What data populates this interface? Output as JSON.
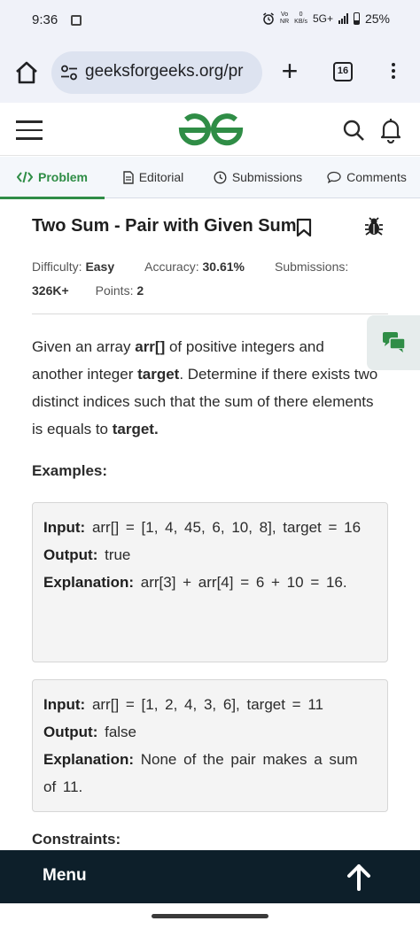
{
  "status_bar": {
    "time": "9:36",
    "network_top": "0",
    "network_bottom": "KB/s",
    "vo_top": "Vo",
    "vo_bottom": "NR",
    "signal": "5G+",
    "battery": "25%"
  },
  "browser": {
    "url": "geeksforgeeks.org/pr",
    "tab_count": "16"
  },
  "tabs": [
    {
      "label": "Problem",
      "icon": "code-icon",
      "active": true
    },
    {
      "label": "Editorial",
      "icon": "document-icon",
      "active": false
    },
    {
      "label": "Submissions",
      "icon": "clock-icon",
      "active": false
    },
    {
      "label": "Comments",
      "icon": "chat-bubble-icon",
      "active": false
    }
  ],
  "problem": {
    "title": "Two Sum - Pair with Given Sum",
    "difficulty_label": "Difficulty:",
    "difficulty_value": "Easy",
    "accuracy_label": "Accuracy:",
    "accuracy_value": "30.61%",
    "submissions_label": "Submissions:",
    "submissions_value": "326K+",
    "points_label": "Points:",
    "points_value": "2",
    "description": {
      "p1": "Given an array ",
      "b1": "arr[]",
      "p2": " of positive integers and another integer ",
      "b2": "target",
      "p3": ". Determine if there exists two distinct indices such that the sum of there elements is equals to ",
      "b3": "target."
    },
    "examples_heading": "Examples:",
    "examples": [
      {
        "input_label": "Input:",
        "input": "arr[] = [1, 4, 45, 6, 10, 8], target = 16",
        "output_label": "Output:",
        "output": "true",
        "explanation_label": "Explanation:",
        "explanation": "arr[3] + arr[4] = 6 + 10 = 16."
      },
      {
        "input_label": "Input:",
        "input": "arr[] = [1, 2, 4, 3, 6], target = 11",
        "output_label": "Output:",
        "output": "false",
        "explanation_label": "Explanation:",
        "explanation": "None of the pair makes a sum of 11."
      }
    ],
    "constraints_heading": "Constraints:"
  },
  "bottom_bar": {
    "menu_label": "Menu"
  },
  "colors": {
    "brand_green": "#2f8d46",
    "menu_bar": "#0d1f2a",
    "browser_chrome": "#f0f2f9"
  }
}
